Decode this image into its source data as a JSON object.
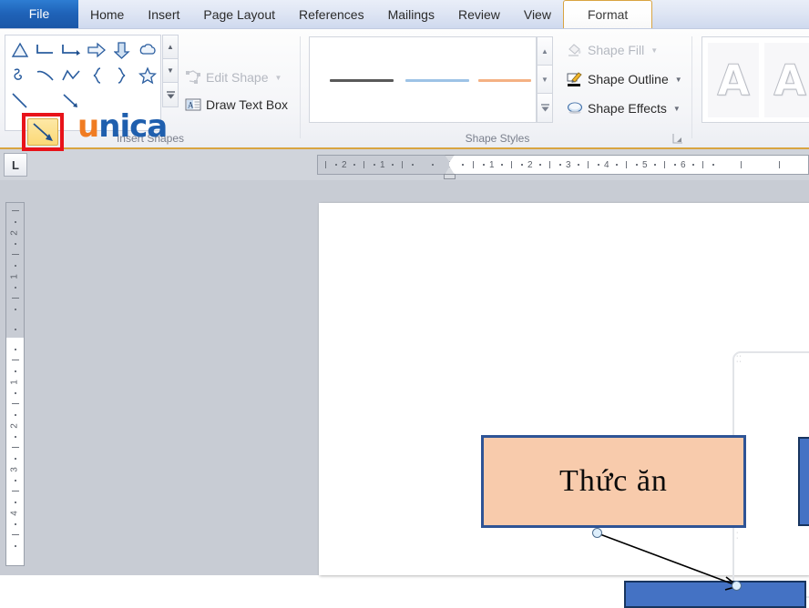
{
  "ribbon": {
    "tabs": [
      {
        "label": "File",
        "state": "file"
      },
      {
        "label": "Home",
        "state": "normal"
      },
      {
        "label": "Insert",
        "state": "normal"
      },
      {
        "label": "Page Layout",
        "state": "normal"
      },
      {
        "label": "References",
        "state": "normal"
      },
      {
        "label": "Mailings",
        "state": "normal"
      },
      {
        "label": "Review",
        "state": "normal"
      },
      {
        "label": "View",
        "state": "normal"
      },
      {
        "label": "Format",
        "state": "active"
      }
    ],
    "groups": {
      "insert_shapes": {
        "label": "Insert Shapes",
        "shapes_row1": [
          "triangle-shape",
          "elbow-connector-shape",
          "elbow-arrow-connector-shape",
          "right-arrow-shape",
          "down-arrow-shape",
          "flowchart-shape"
        ],
        "shapes_row2": [
          "scribble-shape",
          "curve-shape",
          "freeform-shape",
          "left-brace-shape",
          "right-brace-shape",
          "star-shape"
        ],
        "shapes_row3": [
          "line-shape",
          "line-arrow-shape-selected",
          "double-arrow-shape"
        ],
        "selected_shape": "line-arrow-shape",
        "scroll_up": "▲",
        "scroll_down": "▼",
        "more_shapes": "▼",
        "edit_shape": {
          "label": "Edit Shape",
          "icon": "edit-shape-icon",
          "enabled": false,
          "has_dropdown": true
        },
        "draw_text_box": {
          "label": "Draw Text Box",
          "icon": "text-box-icon",
          "enabled": true,
          "has_dropdown": false
        }
      },
      "shape_styles": {
        "label": "Shape Styles",
        "style_swatches": [
          {
            "name": "line-style-dark",
            "color": "#595959"
          },
          {
            "name": "line-style-blue",
            "color": "#9dc3e6"
          },
          {
            "name": "line-style-orange",
            "color": "#f4b183"
          }
        ],
        "scroll_up": "▲",
        "scroll_down": "▼",
        "more_styles": "▼",
        "shape_fill": {
          "label": "Shape Fill",
          "icon": "paint-bucket-icon",
          "enabled": false,
          "has_dropdown": true
        },
        "shape_outline": {
          "label": "Shape Outline",
          "icon": "pen-outline-icon",
          "enabled": true,
          "has_dropdown": true
        },
        "shape_effects": {
          "label": "Shape Effects",
          "icon": "shape-effects-icon",
          "enabled": true,
          "has_dropdown": true
        },
        "dialog_launcher": "dialog-box-launcher-icon"
      },
      "wordart_styles": {
        "label": "",
        "items": [
          {
            "name": "wordart-style-1",
            "glyph": "A"
          },
          {
            "name": "wordart-style-2",
            "glyph": "A"
          }
        ]
      }
    }
  },
  "rulers": {
    "tab_selector": "L",
    "horizontal": {
      "labels_left": [
        "2",
        "1"
      ],
      "labels_right": [
        "1",
        "2",
        "3",
        "4",
        "5",
        "6"
      ]
    },
    "vertical": {
      "labels_grey": [
        "2",
        "1"
      ],
      "labels_white": [
        "1",
        "2",
        "3",
        "4"
      ]
    }
  },
  "document": {
    "shapes": [
      {
        "name": "thuc-an-rectangle",
        "text": "Thức ăn",
        "fill": "#f8cbac",
        "border": "#2e5496"
      },
      {
        "name": "blue-rectangle-right",
        "text": "",
        "fill": "#4472c4",
        "border": "#18355f"
      },
      {
        "name": "blue-rectangle-bottom",
        "text": "",
        "fill": "#4472c4",
        "border": "#18355f"
      }
    ],
    "connector": {
      "name": "arrow-connector",
      "color": "#000000"
    }
  },
  "theme": {
    "accent_orange": "#d9a441",
    "file_tab_blue": "#1f62b8",
    "highlight_red": "#e8131a",
    "watermark_orange": "#f07c22",
    "watermark_blue": "#1f5fae"
  },
  "watermark": {
    "letters": [
      {
        "ch": "u",
        "color": "orange"
      },
      {
        "ch": "n",
        "color": "blue"
      },
      {
        "ch": "i",
        "color": "blue"
      },
      {
        "ch": "c",
        "color": "blue"
      },
      {
        "ch": "a",
        "color": "blue"
      }
    ]
  }
}
